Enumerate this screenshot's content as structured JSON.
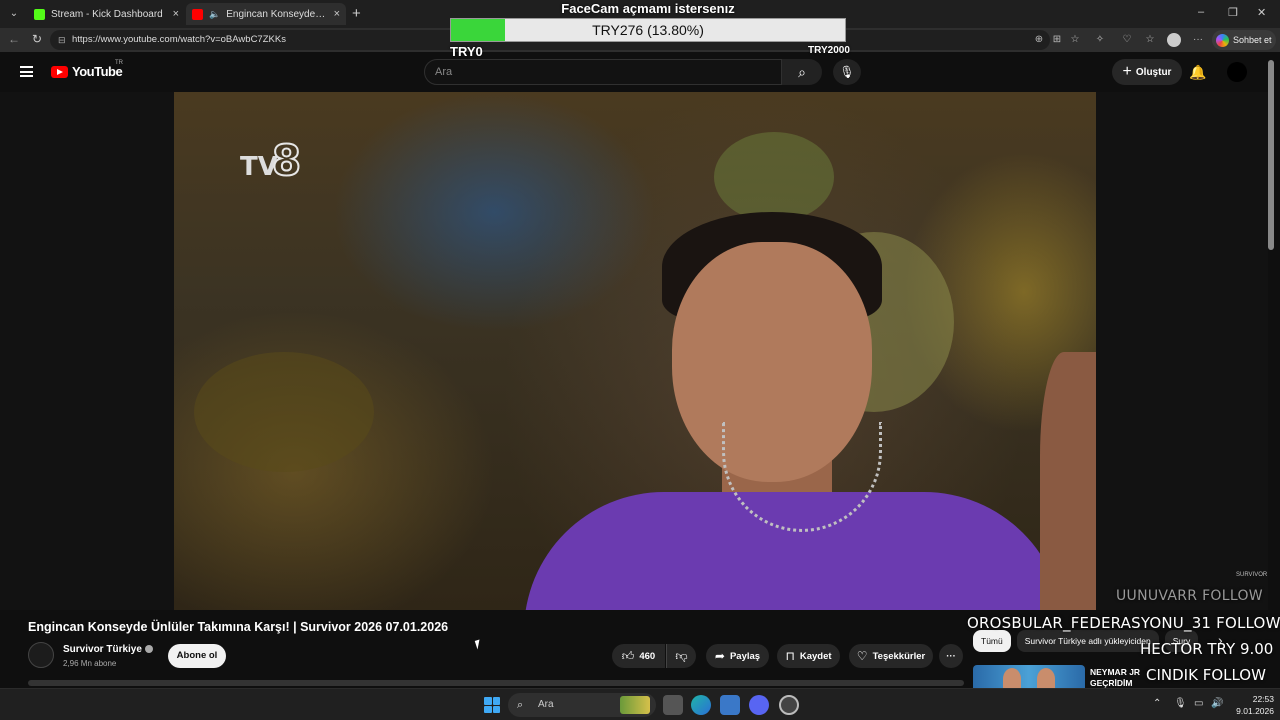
{
  "browser": {
    "tab_list_icon": "chevron-down-icon",
    "tabs": [
      {
        "title": "Stream - Kick Dashboard",
        "favicon_color": "#53fc18",
        "close": "×"
      },
      {
        "title": "Engincan Konseyde Ünlüler Takımına Karşı!",
        "favicon_color": "#ff0000",
        "close": "×"
      }
    ],
    "new_tab": "+",
    "window_controls": {
      "minimize": "–",
      "maximize": "❐",
      "close": "✕"
    },
    "url": "https://www.youtube.com/watch?v=oBAwbC7ZKKs",
    "copilot_label": "Sohbet et"
  },
  "goal_overlay": {
    "title": "FaceCam açmamı istersenız",
    "progress_text": "TRY276 (13.80%)",
    "progress_fraction": 0.138,
    "min_label": "TRY0",
    "max_label": "TRY2000",
    "fill_color": "#3ad63a"
  },
  "youtube": {
    "logo_text": "YouTube",
    "region": "TR",
    "search_placeholder": "Ara",
    "create_label": "Oluştur",
    "brand_color": "#ff0000"
  },
  "video": {
    "channel_watermark": "TV",
    "channel_watermark_num": "8",
    "corner_watermark": "SURVIVOR"
  },
  "details": {
    "title": "Engincan Konseyde Ünlüler Takımına Karşı! | Survivor 2026 07.01.2026",
    "channel_name": "Survivor Türkiye",
    "subscribers": "2,96 Mn abone",
    "subscribe_label": "Abone ol",
    "like_count": "460",
    "share_label": "Paylaş",
    "save_label": "Kaydet",
    "thanks_label": "Teşekkürler",
    "more_label": "···"
  },
  "recommendations": {
    "chips": [
      "Tümü",
      "Survivor Türkiye adlı yükleyiciden",
      "Surv"
    ],
    "first_item_title": "NEYMAR JR GEÇRİDİM"
  },
  "follow_alerts": [
    {
      "text": "UUNUVARR  FOLLOW"
    },
    {
      "text": "OROSBULAR_FEDERASYONU_31  FOLLOW"
    },
    {
      "text": "HECTOR  TRY 9.00"
    },
    {
      "text": "CINDIK  FOLLOW"
    }
  ],
  "taskbar": {
    "search_placeholder": "Ara",
    "time": "22:53",
    "date": "9.01.2026",
    "accent_color": "#3fa9f5"
  }
}
